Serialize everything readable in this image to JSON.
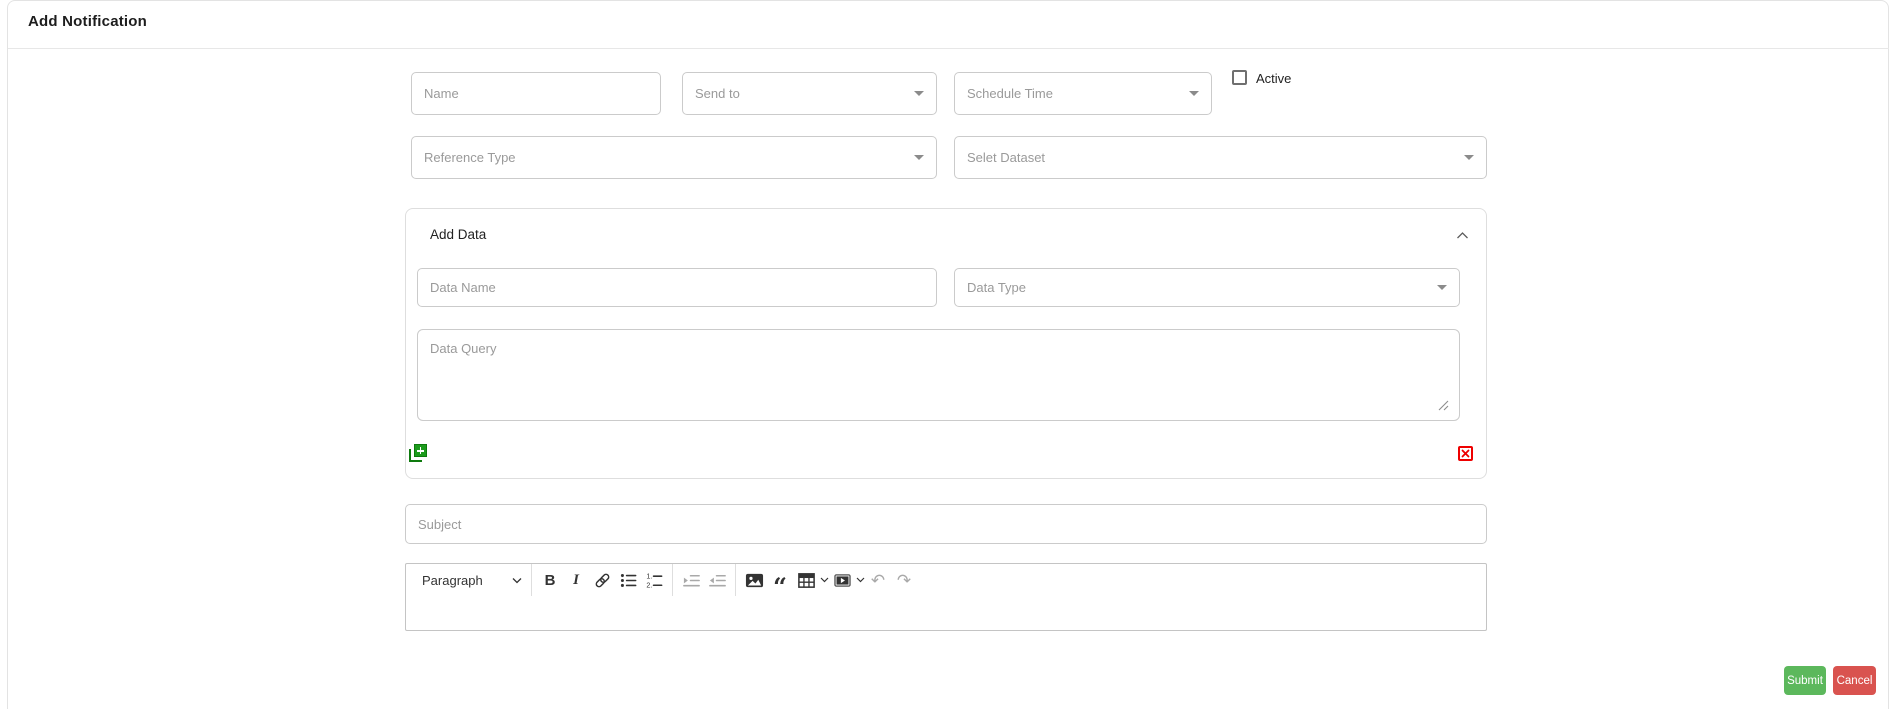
{
  "header": {
    "title": "Add Notification"
  },
  "form": {
    "name_placeholder": "Name",
    "send_to_placeholder": "Send to",
    "schedule_time_placeholder": "Schedule Time",
    "active_label": "Active",
    "active_checked": false,
    "reference_type_placeholder": "Reference Type",
    "select_dataset_placeholder": "Selet Dataset",
    "subject_placeholder": "Subject"
  },
  "add_data": {
    "title": "Add Data",
    "data_name_placeholder": "Data Name",
    "data_type_placeholder": "Data Type",
    "data_query_placeholder": "Data Query"
  },
  "editor": {
    "paragraph_label": "Paragraph",
    "bold_label": "B",
    "italic_label": "I",
    "quote_glyph": "“",
    "undo_glyph": "↶",
    "redo_glyph": "↷",
    "content": ""
  },
  "actions": {
    "submit_label": "Submit",
    "cancel_label": "Cancel"
  },
  "colors": {
    "submit_green": "#5cb85c",
    "cancel_red": "#d9534f",
    "add_icon_green": "#1d9b1d",
    "remove_icon_red": "#ee0000",
    "input_border": "#cbcbcb",
    "card_border": "#e3e3e3"
  }
}
